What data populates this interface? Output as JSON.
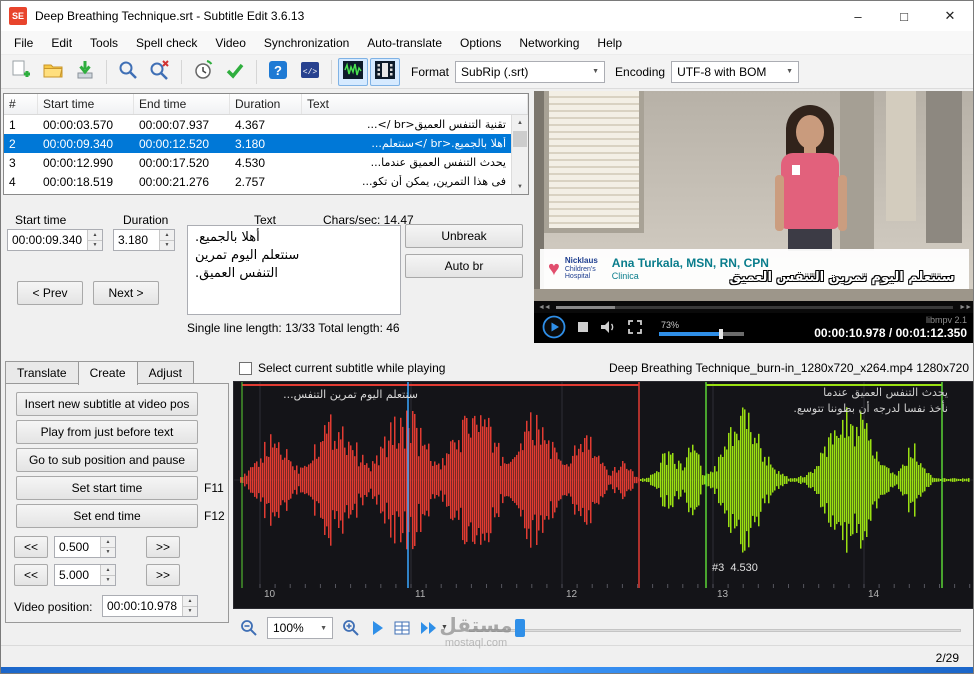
{
  "window": {
    "title": "Deep Breathing Technique.srt - Subtitle Edit 3.6.13",
    "app_initials": "SE",
    "controls": {
      "min": "–",
      "max": "□",
      "close": "✕"
    },
    "status_right": "2/29"
  },
  "menu": [
    "File",
    "Edit",
    "Tools",
    "Spell check",
    "Video",
    "Synchronization",
    "Auto-translate",
    "Options",
    "Networking",
    "Help"
  ],
  "toolbar": {
    "format_label": "Format",
    "format_value": "SubRip (.srt)",
    "encoding_label": "Encoding",
    "encoding_value": "UTF-8 with BOM"
  },
  "list": {
    "columns": [
      "#",
      "Start time",
      "End time",
      "Duration",
      "Text"
    ],
    "rows": [
      {
        "n": "1",
        "start": "00:00:03.570",
        "end": "00:00:07.937",
        "dur": "4.367",
        "text": "تقنية التنفس العميق<br />..."
      },
      {
        "n": "2",
        "start": "00:00:09.340",
        "end": "00:00:12.520",
        "dur": "3.180",
        "text": "أهلا بالجميع.<br />سنتعلم..."
      },
      {
        "n": "3",
        "start": "00:00:12.990",
        "end": "00:00:17.520",
        "dur": "4.530",
        "text": "يحدث التنفس العميق عندما..."
      },
      {
        "n": "4",
        "start": "00:00:18.519",
        "end": "00:00:21.276",
        "dur": "2.757",
        "text": "فى هذا التمرين, يمكن أن تكو..."
      }
    ]
  },
  "editor": {
    "start_label": "Start time",
    "duration_label": "Duration",
    "text_label": "Text",
    "charsec_label": "Chars/sec: 14.47",
    "start_value": "00:00:09.340",
    "duration_value": "3.180",
    "text_value": "أهلا بالجميع.\nسنتعلم اليوم تمرين\nالتنفس العميق.",
    "unbreak": "Unbreak",
    "autobr": "Auto br",
    "prev": "< Prev",
    "next": "Next >",
    "line_info": "Single line length: 13/33 Total length: 46"
  },
  "video": {
    "logo_line1": "Nicklaus",
    "logo_line2": "Children's",
    "logo_line3": "Hospital",
    "caption_name": "Ana Turkala, MSN, RN, CPN",
    "caption_sub": "Clinica",
    "burnin_subtitle": "سنتعلم اليوم تمرين التنفس العميق",
    "volume": "73%",
    "engine": "libmpv 2.1",
    "time": "00:00:10.978 / 00:01:12.350"
  },
  "panel": {
    "tabs": [
      "Translate",
      "Create",
      "Adjust"
    ],
    "buttons": [
      {
        "label": "Insert new subtitle at video pos",
        "key": ""
      },
      {
        "label": "Play from just before text",
        "key": ""
      },
      {
        "label": "Go to sub position and pause",
        "key": ""
      },
      {
        "label": "Set start time",
        "key": "F11"
      },
      {
        "label": "Set end time",
        "key": "F12"
      }
    ],
    "nudge1": "0.500",
    "nudge2": "5.000",
    "rew": "<<",
    "fwd": ">>",
    "video_pos_label": "Video position:",
    "video_pos_value": "00:00:10.978"
  },
  "waveform": {
    "select_checkbox": "Select current subtitle while playing",
    "file_label": "Deep Breathing Technique_burn-in_1280x720_x264.mp4 1280x720",
    "overlay_left": "سنتعلم اليوم تمرين التنفس...",
    "overlay_right1": "يحدث التنفس العميق عندما",
    "overlay_right2": "نأخذ نفسا لدرجه أن بطوننا تتوسع.",
    "marker_label": "#3  4.530",
    "ruler": [
      "10",
      "11",
      "12",
      "13",
      "14"
    ],
    "zoom_value": "100%"
  },
  "watermark": {
    "arabic": "مستقل",
    "latin": "mostaql.com"
  },
  "colors": {
    "selection": "#0078d7",
    "wave_red": "#e23b32",
    "wave_green": "#9ae012",
    "accent_blue": "#2f8fe8"
  }
}
